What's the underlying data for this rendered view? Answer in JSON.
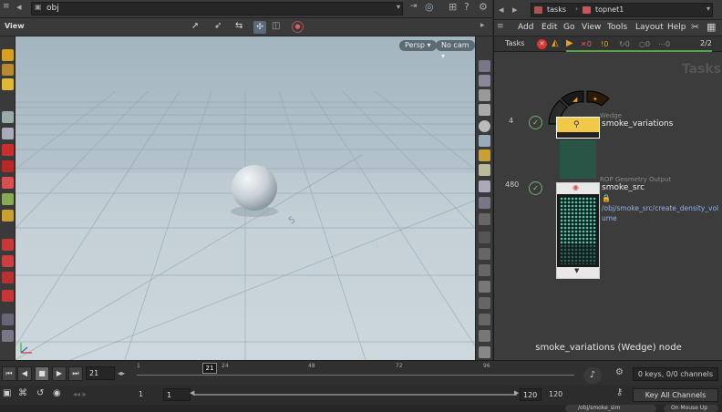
{
  "viewer": {
    "path": "obj",
    "view_label": "View",
    "persp_label": "Persp",
    "cam_label": "No cam",
    "grid_number": "5"
  },
  "network": {
    "tab_tasks": "tasks",
    "tab_topnet": "topnet1",
    "menu": [
      "Add",
      "Edit",
      "Go",
      "View",
      "Tools",
      "Layout",
      "Help"
    ],
    "tasks_label": "Tasks",
    "counts": [
      "0",
      "0",
      "0",
      "0",
      "0"
    ],
    "page_indicator": "2/2",
    "watermark": "Tasks",
    "node1": {
      "type": "Wedge",
      "name": "smoke_variations",
      "count": "4"
    },
    "node2": {
      "type": "ROP Geometry Output",
      "name": "smoke_src",
      "count": "480",
      "param_line1": "/obj/smoke_src/create_density_vol",
      "param_line2": "ume"
    },
    "footer": "smoke_variations (Wedge) node"
  },
  "timeline": {
    "current_frame": "21",
    "ticks": [
      "1",
      "24",
      "48",
      "72",
      "96"
    ],
    "keys_label": "0 keys, 0/0 channels",
    "key_all_label": "Key All Channels",
    "range_start": "1",
    "range_field": "1",
    "range_end_field": "120",
    "range_end": "120"
  },
  "status": {
    "path": "/obj/smoke_sim",
    "mode": "On Mouse Up"
  },
  "colors": {
    "accent_orange": "#e8a020",
    "node_green": "#1fa590",
    "selected_yellow": "#f0c040"
  }
}
